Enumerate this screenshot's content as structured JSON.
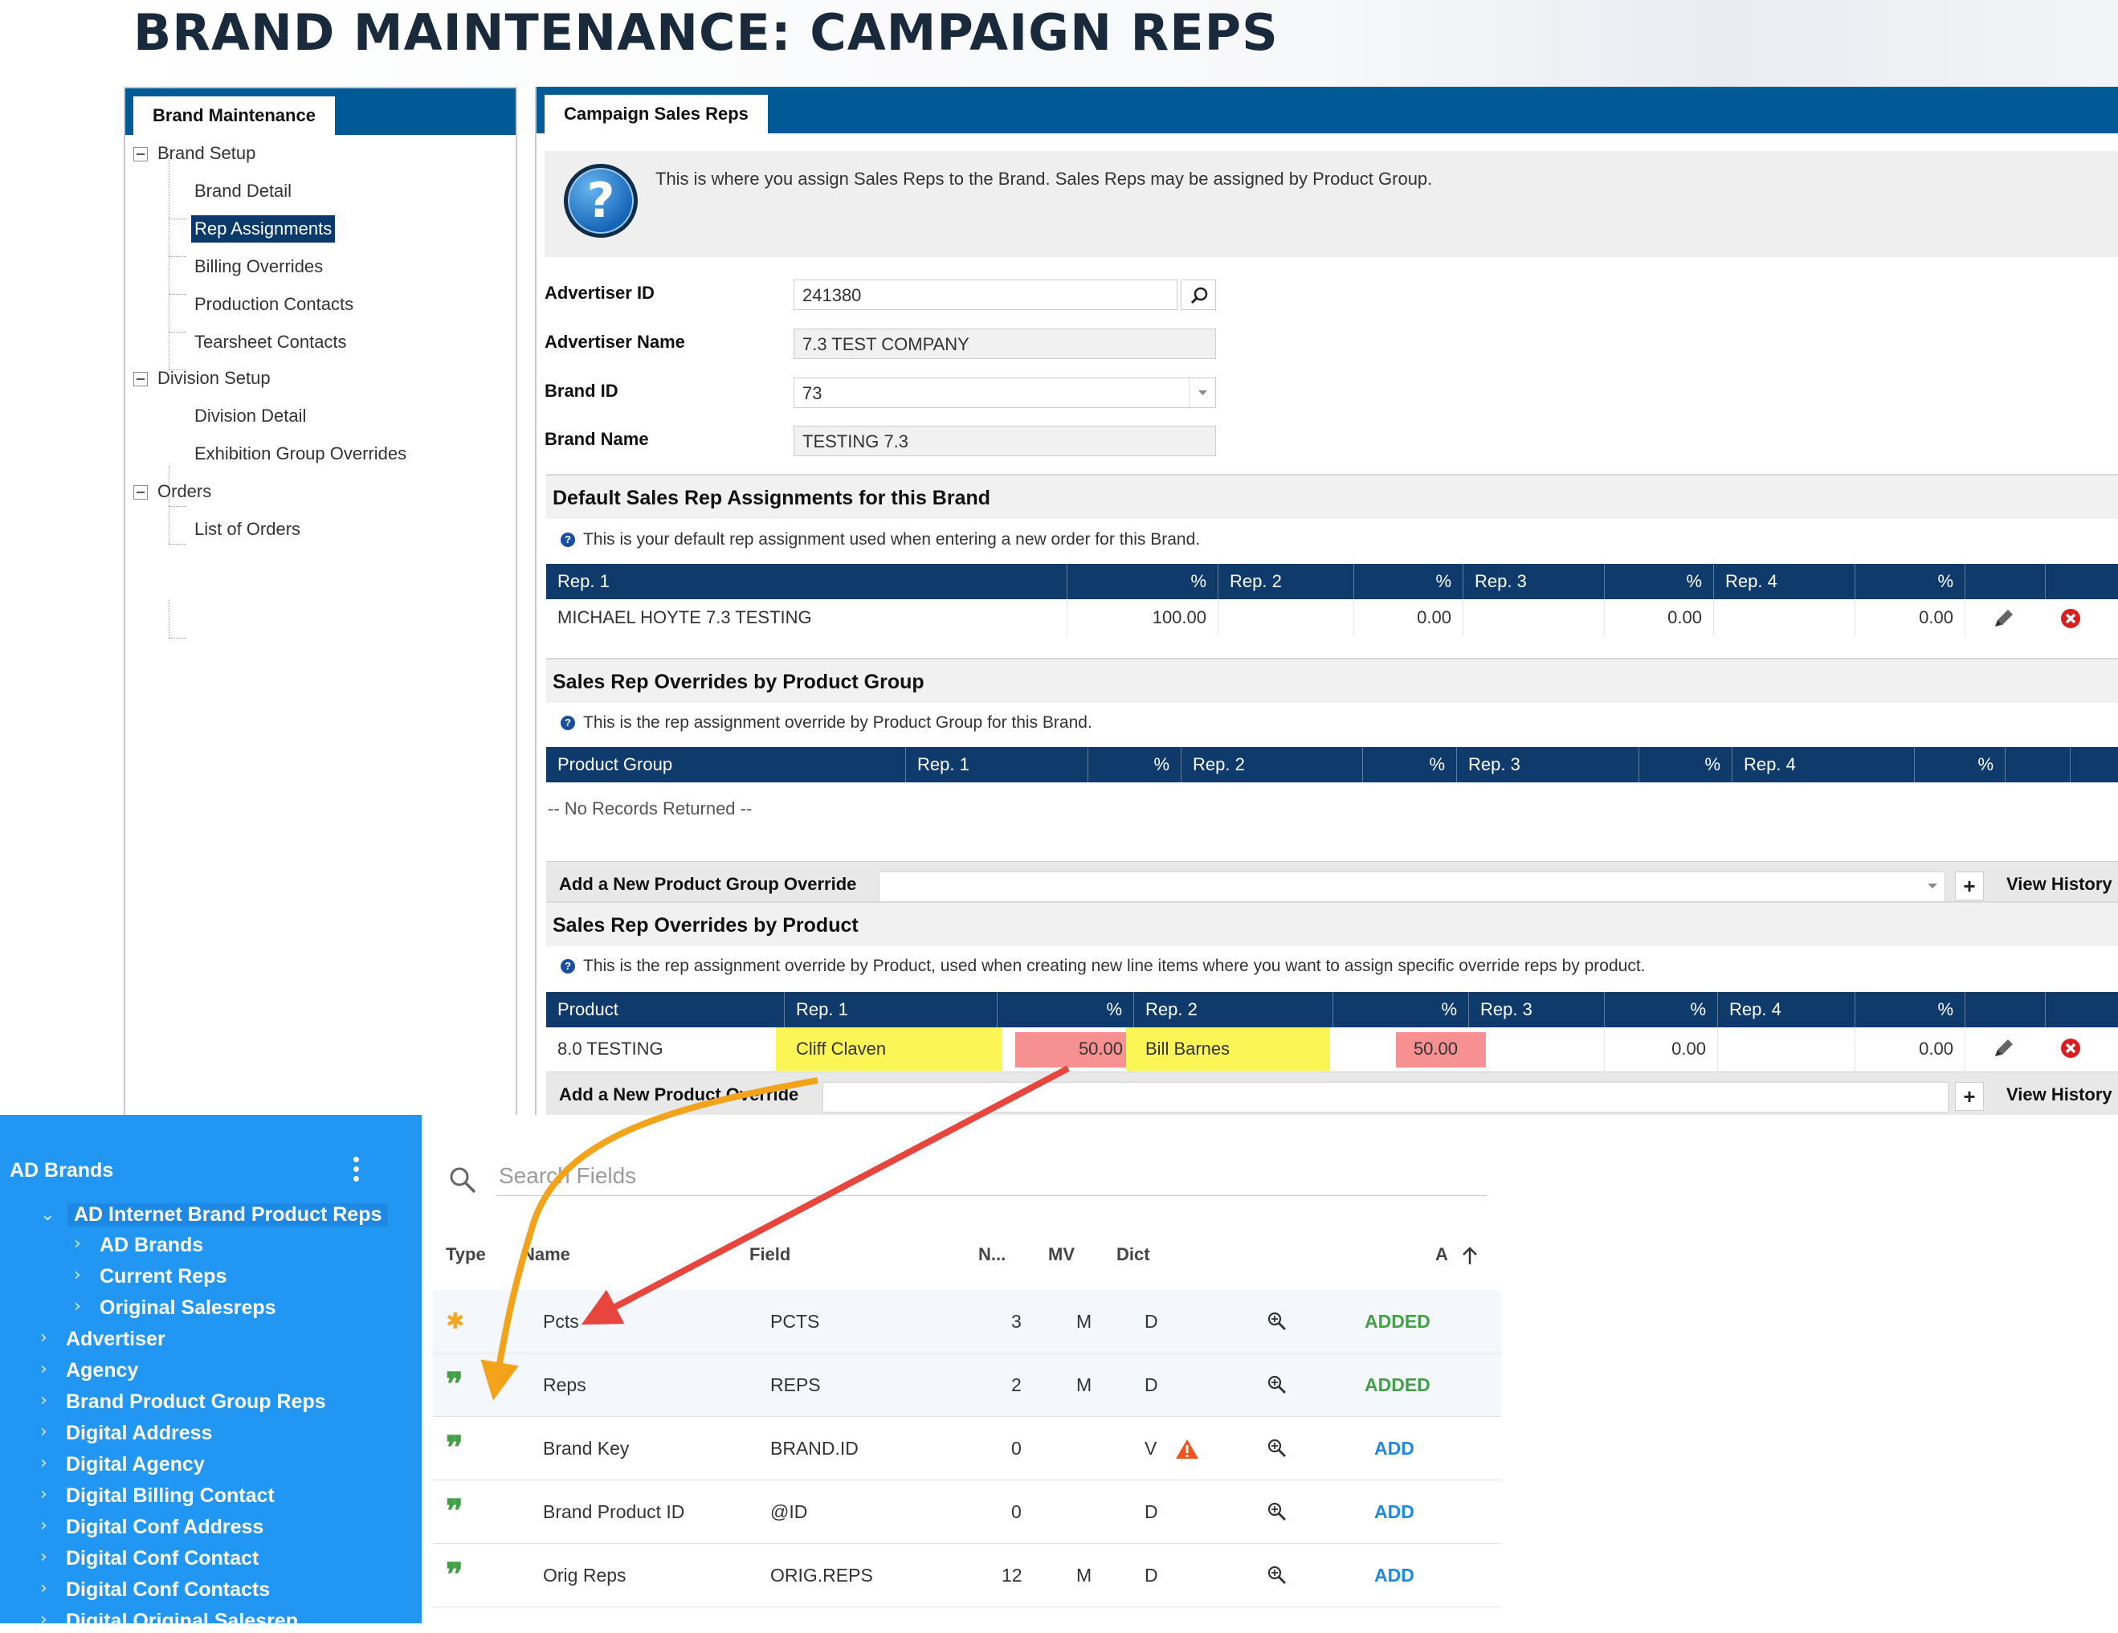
{
  "page_title": "BRAND MAINTENANCE: CAMPAIGN REPS",
  "tree": {
    "tab": "Brand Maintenance",
    "nodes": [
      {
        "label": "Brand Setup"
      },
      {
        "label": "Brand Detail"
      },
      {
        "label": "Rep Assignments"
      },
      {
        "label": "Billing Overrides"
      },
      {
        "label": "Production Contacts"
      },
      {
        "label": "Tearsheet Contacts"
      },
      {
        "label": "Division Setup"
      },
      {
        "label": "Division Detail"
      },
      {
        "label": "Exhibition Group Overrides"
      },
      {
        "label": "Orders"
      },
      {
        "label": "List of Orders"
      }
    ]
  },
  "content": {
    "tab": "Campaign Sales Reps",
    "help_text": "This is where you assign Sales Reps to the Brand. Sales Reps may be assigned by Product Group.",
    "help_icon_glyph": "?",
    "form": {
      "advertiser_id_label": "Advertiser ID",
      "advertiser_id": "241380",
      "advertiser_name_label": "Advertiser Name",
      "advertiser_name": "7.3 TEST COMPANY",
      "brand_id_label": "Brand ID",
      "brand_id": "73",
      "brand_name_label": "Brand Name",
      "brand_name": "TESTING 7.3"
    },
    "default_section": {
      "title": "Default Sales Rep Assignments for this Brand",
      "note": "This is your default rep assignment used when entering a new order for this Brand.",
      "headers": [
        "Rep. 1",
        "%",
        "Rep. 2",
        "%",
        "Rep. 3",
        "%",
        "Rep. 4",
        "%"
      ],
      "row": [
        "MICHAEL HOYTE 7.3 TESTING",
        "100.00",
        "",
        "0.00",
        "",
        "0.00",
        "",
        "0.00"
      ]
    },
    "group_section": {
      "title": "Sales Rep Overrides by Product Group",
      "note": "This is the rep assignment override by Product Group for this Brand.",
      "headers": [
        "Product Group",
        "Rep. 1",
        "%",
        "Rep. 2",
        "%",
        "Rep. 3",
        "%",
        "Rep. 4",
        "%"
      ],
      "empty": "-- No Records Returned --",
      "add_label": "Add a New Product Group Override",
      "add_plus": "+",
      "view_history": "View History"
    },
    "product_section": {
      "title": "Sales Rep Overrides by Product",
      "note": "This is the rep assignment override by Product, used when creating new line items where you want to assign specific override reps by product.",
      "headers": [
        "Product",
        "Rep. 1",
        "%",
        "Rep. 2",
        "%",
        "Rep. 3",
        "%",
        "Rep. 4",
        "%"
      ],
      "row": [
        "8.0 TESTING",
        "Cliff Claven",
        "50.00",
        "Bill Barnes",
        "50.00",
        "",
        "0.00",
        "",
        "0.00"
      ],
      "add_label": "Add a New Product Override",
      "add_plus": "+",
      "view_history": "View History"
    },
    "info_glyph": "?"
  },
  "sidebar": {
    "title": "AD Brands",
    "items": [
      {
        "label": "AD Internet Brand Product Reps"
      },
      {
        "label": "AD Brands"
      },
      {
        "label": "Current Reps"
      },
      {
        "label": "Original Salesreps"
      },
      {
        "label": "Advertiser"
      },
      {
        "label": "Agency"
      },
      {
        "label": "Brand Product Group Reps"
      },
      {
        "label": "Digital Address"
      },
      {
        "label": "Digital Agency"
      },
      {
        "label": "Digital Billing Contact"
      },
      {
        "label": "Digital Conf Address"
      },
      {
        "label": "Digital Conf Contact"
      },
      {
        "label": "Digital Conf Contacts"
      },
      {
        "label": "Digital Original Salesrep"
      }
    ]
  },
  "fields": {
    "search_placeholder": "Search Fields",
    "columns": {
      "type": "Type",
      "name": "Name",
      "field": "Field",
      "n": "N...",
      "mv": "MV",
      "dict": "Dict",
      "a": "A"
    },
    "rows": [
      {
        "type_icon": "star-icon",
        "name": "Pcts",
        "field": "PCTS",
        "n": "3",
        "mv": "M",
        "dict": "D",
        "action": "ADDED"
      },
      {
        "type_icon": "quote-icon",
        "name": "Reps",
        "field": "REPS",
        "n": "2",
        "mv": "M",
        "dict": "D",
        "action": "ADDED"
      },
      {
        "type_icon": "quote-icon",
        "name": "Brand Key",
        "field": "BRAND.ID",
        "n": "0",
        "mv": "",
        "dict": "V",
        "warning": true,
        "action": "ADD"
      },
      {
        "type_icon": "quote-icon",
        "name": "Brand Product ID",
        "field": "@ID",
        "n": "0",
        "mv": "",
        "dict": "D",
        "action": "ADD"
      },
      {
        "type_icon": "quote-icon",
        "name": "Orig Reps",
        "field": "ORIG.REPS",
        "n": "12",
        "mv": "M",
        "dict": "D",
        "action": "ADD"
      }
    ]
  },
  "colors": {
    "header_navy": "#0f3a6c",
    "tab_blue": "#005a96",
    "sidebar_blue": "#2196f3",
    "added_green": "#43a047",
    "add_blue": "#1e88e5",
    "highlight_yellow": "#fbf54c",
    "highlight_red": "#f78b8b",
    "arrow_orange": "#f2a31a",
    "arrow_red": "#e8453c"
  }
}
